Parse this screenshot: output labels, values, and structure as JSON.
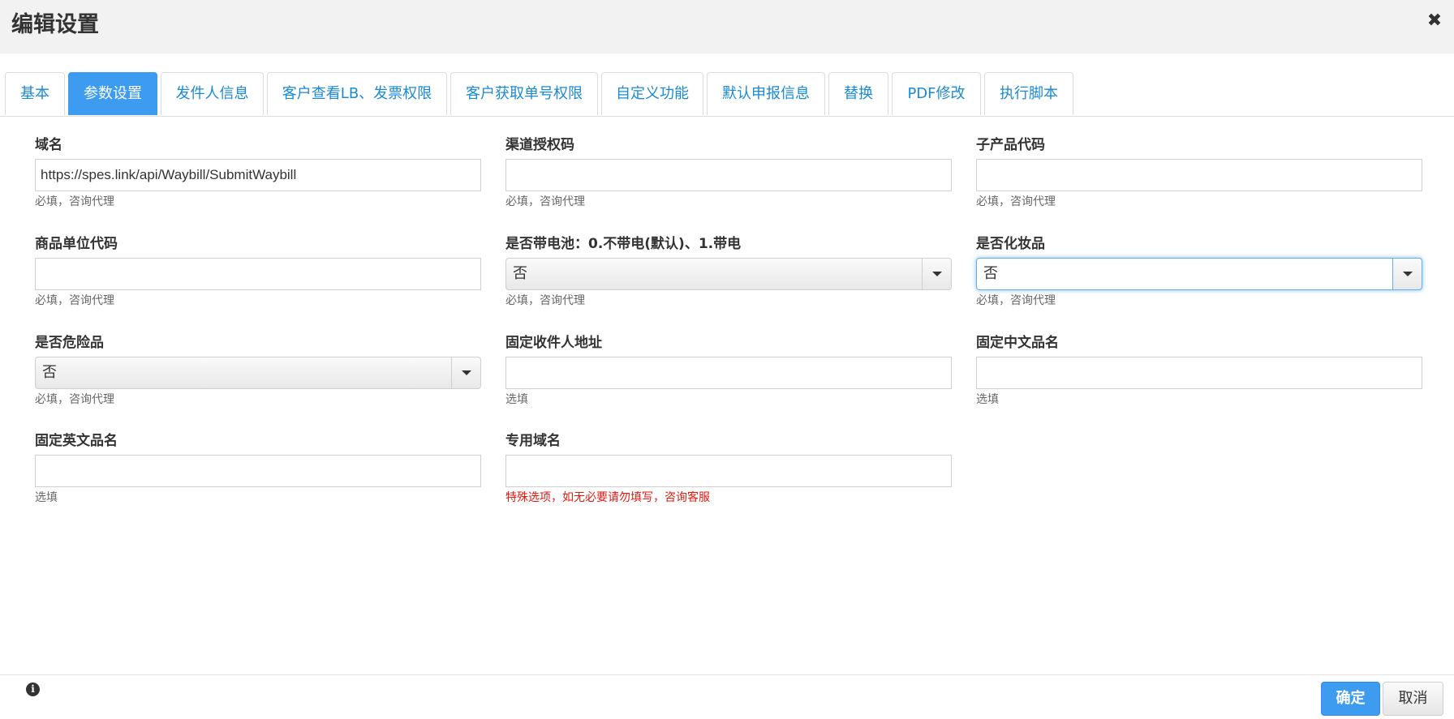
{
  "dialog": {
    "title": "编辑设置",
    "close_icon": "close-icon"
  },
  "tabs": [
    {
      "label": "基本",
      "active": false
    },
    {
      "label": "参数设置",
      "active": true
    },
    {
      "label": "发件人信息",
      "active": false
    },
    {
      "label": "客户查看LB、发票权限",
      "active": false
    },
    {
      "label": "客户获取单号权限",
      "active": false
    },
    {
      "label": "自定义功能",
      "active": false
    },
    {
      "label": "默认申报信息",
      "active": false
    },
    {
      "label": "替换",
      "active": false
    },
    {
      "label": "PDF修改",
      "active": false
    },
    {
      "label": "执行脚本",
      "active": false
    }
  ],
  "form": {
    "domain": {
      "label": "域名",
      "value": "https://spes.link/api/Waybill/SubmitWaybill",
      "hint": "必填，咨询代理"
    },
    "channel_auth_code": {
      "label": "渠道授权码",
      "value": "",
      "hint": "必填，咨询代理"
    },
    "sub_product_code": {
      "label": "子产品代码",
      "value": "",
      "hint": "必填，咨询代理"
    },
    "goods_unit_code": {
      "label": "商品单位代码",
      "value": "",
      "hint": "必填，咨询代理"
    },
    "battery": {
      "label": "是否带电池：0.不带电(默认)、1.带电",
      "value": "否",
      "hint": "必填，咨询代理"
    },
    "cosmetics": {
      "label": "是否化妆品",
      "value": "否",
      "hint": "必填，咨询代理"
    },
    "dangerous": {
      "label": "是否危险品",
      "value": "否",
      "hint": "必填，咨询代理"
    },
    "fixed_receiver_address": {
      "label": "固定收件人地址",
      "value": "",
      "hint": "选填"
    },
    "fixed_cn_name": {
      "label": "固定中文品名",
      "value": "",
      "hint": "选填"
    },
    "fixed_en_name": {
      "label": "固定英文品名",
      "value": "",
      "hint": "选填"
    },
    "dedicated_domain": {
      "label": "专用域名",
      "value": "",
      "hint": "特殊选项，如无必要请勿填写，咨询客服"
    }
  },
  "footer": {
    "info_icon": "info-icon",
    "ok_label": "确定",
    "cancel_label": "取消"
  },
  "colors": {
    "accent": "#3e9cf0",
    "tab_text": "#1a8ad4",
    "warning": "#e0190f",
    "header_bg": "#f2f2f2"
  }
}
